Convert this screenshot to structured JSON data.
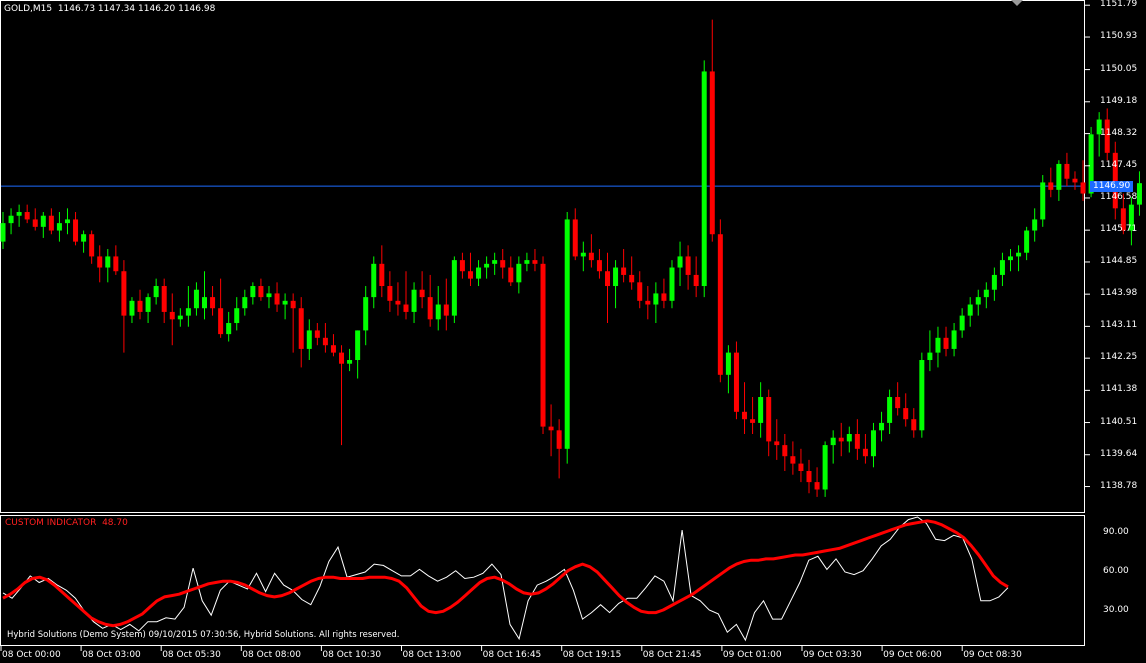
{
  "chart_info": {
    "symbol": "GOLD,M15",
    "open": "1146.73",
    "high": "1147.34",
    "low": "1146.20",
    "close": "1146.98",
    "current_price_tag": "1146.90"
  },
  "indicator": {
    "title": "CUSTOM INDICATOR",
    "value": "48.70",
    "copyright": "Hybrid Solutions (Demo System) 09/10/2015 07:30:56, Hybrid Solutions. All rights reserved."
  },
  "price_axis": [
    "1151.79",
    "1150.93",
    "1150.05",
    "1149.18",
    "1148.32",
    "1147.45",
    "1146.58",
    "1145.71",
    "1144.85",
    "1143.98",
    "1143.11",
    "1142.25",
    "1141.38",
    "1140.51",
    "1139.64",
    "1138.78"
  ],
  "indicator_axis": [
    "90.00",
    "60.00",
    "30.00"
  ],
  "time_axis": [
    "08 Oct 00:00",
    "08 Oct 03:00",
    "08 Oct 05:30",
    "08 Oct 08:00",
    "08 Oct 10:30",
    "08 Oct 13:00",
    "08 Oct 16:45",
    "08 Oct 19:15",
    "08 Oct 21:45",
    "09 Oct 01:00",
    "09 Oct 03:30",
    "09 Oct 06:00",
    "09 Oct 08:30"
  ],
  "colors": {
    "bull": "#00ff00",
    "bear": "#ff0000",
    "price_line": "#1c6bff",
    "signal": "#ff0000",
    "raw": "#ffffff"
  },
  "chart_data": {
    "type": "candlestick",
    "ylim": [
      1138.2,
      1151.85
    ],
    "candles": [
      [
        1145.4,
        1146.2,
        1145.2,
        1145.9
      ],
      [
        1145.9,
        1146.3,
        1145.6,
        1146.1
      ],
      [
        1146.1,
        1146.4,
        1145.8,
        1146.2
      ],
      [
        1146.2,
        1146.4,
        1145.9,
        1146.0
      ],
      [
        1146.0,
        1146.3,
        1145.7,
        1145.8
      ],
      [
        1145.8,
        1146.2,
        1145.5,
        1146.1
      ],
      [
        1146.1,
        1146.3,
        1145.6,
        1145.7
      ],
      [
        1145.7,
        1146.2,
        1145.4,
        1145.9
      ],
      [
        1145.9,
        1146.3,
        1145.6,
        1146.0
      ],
      [
        1146.0,
        1146.2,
        1145.3,
        1145.4
      ],
      [
        1145.4,
        1145.7,
        1145.1,
        1145.6
      ],
      [
        1145.6,
        1145.7,
        1144.8,
        1145.0
      ],
      [
        1145.0,
        1145.3,
        1144.3,
        1144.7
      ],
      [
        1144.7,
        1145.2,
        1144.3,
        1145.0
      ],
      [
        1145.0,
        1145.3,
        1144.5,
        1144.6
      ],
      [
        1144.6,
        1144.9,
        1142.4,
        1143.4
      ],
      [
        1143.4,
        1143.9,
        1143.2,
        1143.8
      ],
      [
        1143.8,
        1144.1,
        1143.3,
        1143.5
      ],
      [
        1143.5,
        1144.0,
        1143.2,
        1143.9
      ],
      [
        1143.9,
        1144.4,
        1143.7,
        1144.2
      ],
      [
        1144.2,
        1144.4,
        1143.2,
        1143.5
      ],
      [
        1143.5,
        1144.0,
        1142.6,
        1143.3
      ],
      [
        1143.3,
        1143.6,
        1143.1,
        1143.4
      ],
      [
        1143.4,
        1144.2,
        1143.1,
        1143.6
      ],
      [
        1143.6,
        1144.3,
        1143.4,
        1144.1
      ],
      [
        1143.6,
        1144.6,
        1143.3,
        1143.9
      ],
      [
        1143.9,
        1144.2,
        1143.4,
        1143.6
      ],
      [
        1143.6,
        1144.4,
        1142.8,
        1142.9
      ],
      [
        1142.9,
        1143.5,
        1142.7,
        1143.2
      ],
      [
        1143.2,
        1143.9,
        1143.0,
        1143.6
      ],
      [
        1143.6,
        1144.1,
        1143.4,
        1143.9
      ],
      [
        1143.9,
        1144.3,
        1143.7,
        1144.2
      ],
      [
        1144.2,
        1144.4,
        1143.8,
        1143.9
      ],
      [
        1143.9,
        1144.2,
        1143.6,
        1144.0
      ],
      [
        1144.0,
        1144.3,
        1143.5,
        1143.7
      ],
      [
        1143.7,
        1144.0,
        1143.3,
        1143.8
      ],
      [
        1143.8,
        1144.0,
        1142.4,
        1143.6
      ],
      [
        1143.6,
        1143.9,
        1142.0,
        1142.5
      ],
      [
        1142.5,
        1143.3,
        1142.2,
        1143.0
      ],
      [
        1143.0,
        1143.2,
        1142.6,
        1142.8
      ],
      [
        1142.8,
        1143.2,
        1142.4,
        1142.6
      ],
      [
        1142.6,
        1142.9,
        1142.3,
        1142.4
      ],
      [
        1142.4,
        1142.6,
        1139.9,
        1142.1
      ],
      [
        1142.1,
        1142.5,
        1141.9,
        1142.2
      ],
      [
        1142.2,
        1143.0,
        1141.7,
        1143.0
      ],
      [
        1143.0,
        1144.2,
        1142.6,
        1143.9
      ],
      [
        1143.9,
        1145.0,
        1143.6,
        1144.8
      ],
      [
        1144.8,
        1145.3,
        1143.9,
        1144.2
      ],
      [
        1144.2,
        1144.6,
        1143.5,
        1143.8
      ],
      [
        1143.8,
        1144.3,
        1143.4,
        1143.7
      ],
      [
        1143.7,
        1144.6,
        1143.3,
        1143.5
      ],
      [
        1143.5,
        1144.3,
        1143.2,
        1144.1
      ],
      [
        1144.1,
        1144.6,
        1143.6,
        1143.9
      ],
      [
        1143.9,
        1144.5,
        1143.1,
        1143.3
      ],
      [
        1143.3,
        1144.2,
        1143.0,
        1143.7
      ],
      [
        1143.7,
        1144.4,
        1143.0,
        1143.4
      ],
      [
        1143.4,
        1145.0,
        1143.2,
        1144.9
      ],
      [
        1144.9,
        1145.1,
        1144.4,
        1144.6
      ],
      [
        1144.6,
        1145.1,
        1144.2,
        1144.4
      ],
      [
        1144.4,
        1144.9,
        1144.2,
        1144.7
      ],
      [
        1144.7,
        1145.0,
        1144.4,
        1144.8
      ],
      [
        1144.8,
        1145.1,
        1144.5,
        1144.9
      ],
      [
        1144.9,
        1145.2,
        1144.4,
        1144.7
      ],
      [
        1144.7,
        1145.0,
        1144.2,
        1144.3
      ],
      [
        1144.3,
        1145.0,
        1144.0,
        1144.8
      ],
      [
        1144.8,
        1145.1,
        1144.6,
        1144.9
      ],
      [
        1144.9,
        1145.2,
        1144.6,
        1144.8
      ],
      [
        1144.8,
        1145.0,
        1140.2,
        1140.4
      ],
      [
        1140.4,
        1141.0,
        1139.6,
        1140.3
      ],
      [
        1140.3,
        1140.6,
        1139.0,
        1139.8
      ],
      [
        1139.8,
        1146.2,
        1139.4,
        1146.0
      ],
      [
        1146.0,
        1146.3,
        1144.9,
        1145.0
      ],
      [
        1145.0,
        1145.4,
        1144.6,
        1145.1
      ],
      [
        1145.1,
        1145.6,
        1144.7,
        1144.9
      ],
      [
        1144.9,
        1145.2,
        1144.4,
        1144.6
      ],
      [
        1144.6,
        1145.1,
        1143.2,
        1144.2
      ],
      [
        1144.2,
        1144.9,
        1143.6,
        1144.7
      ],
      [
        1144.7,
        1145.2,
        1144.3,
        1144.5
      ],
      [
        1144.5,
        1145.0,
        1144.1,
        1144.3
      ],
      [
        1144.3,
        1144.6,
        1143.6,
        1143.8
      ],
      [
        1143.8,
        1144.2,
        1143.3,
        1143.7
      ],
      [
        1143.7,
        1144.3,
        1143.2,
        1144.0
      ],
      [
        1144.0,
        1144.4,
        1143.6,
        1143.8
      ],
      [
        1143.8,
        1144.9,
        1143.6,
        1144.7
      ],
      [
        1144.7,
        1145.4,
        1144.2,
        1145.0
      ],
      [
        1145.0,
        1145.3,
        1144.1,
        1144.5
      ],
      [
        1144.5,
        1145.0,
        1143.9,
        1144.2
      ],
      [
        1144.2,
        1150.3,
        1143.9,
        1150.0
      ],
      [
        1150.0,
        1151.4,
        1145.4,
        1145.6
      ],
      [
        1145.6,
        1146.0,
        1141.6,
        1141.8
      ],
      [
        1141.8,
        1142.6,
        1141.3,
        1142.4
      ],
      [
        1142.4,
        1142.7,
        1140.6,
        1140.8
      ],
      [
        1140.8,
        1141.6,
        1140.2,
        1140.6
      ],
      [
        1140.6,
        1141.2,
        1140.2,
        1140.5
      ],
      [
        1140.5,
        1141.6,
        1140.1,
        1141.2
      ],
      [
        1141.2,
        1141.4,
        1139.6,
        1140.0
      ],
      [
        1140.0,
        1140.6,
        1139.5,
        1139.9
      ],
      [
        1139.9,
        1140.2,
        1139.2,
        1139.6
      ],
      [
        1139.6,
        1140.0,
        1139.1,
        1139.4
      ],
      [
        1139.4,
        1139.8,
        1138.9,
        1139.2
      ],
      [
        1139.2,
        1139.5,
        1138.6,
        1138.9
      ],
      [
        1138.9,
        1139.3,
        1138.5,
        1138.7
      ],
      [
        1138.7,
        1140.0,
        1138.5,
        1139.9
      ],
      [
        1139.9,
        1140.3,
        1139.4,
        1140.1
      ],
      [
        1140.1,
        1140.5,
        1139.6,
        1140.0
      ],
      [
        1140.0,
        1140.4,
        1139.7,
        1140.2
      ],
      [
        1140.2,
        1140.6,
        1139.5,
        1139.8
      ],
      [
        1139.8,
        1140.2,
        1139.4,
        1139.6
      ],
      [
        1139.6,
        1140.5,
        1139.3,
        1140.3
      ],
      [
        1140.3,
        1140.8,
        1140.0,
        1140.5
      ],
      [
        1140.5,
        1141.4,
        1140.2,
        1141.2
      ],
      [
        1141.2,
        1141.6,
        1140.7,
        1140.9
      ],
      [
        1140.9,
        1141.3,
        1140.4,
        1140.6
      ],
      [
        1140.6,
        1140.9,
        1140.1,
        1140.3
      ],
      [
        1140.3,
        1142.4,
        1140.1,
        1142.2
      ],
      [
        1142.2,
        1143.0,
        1141.9,
        1142.4
      ],
      [
        1142.4,
        1143.1,
        1142.0,
        1142.8
      ],
      [
        1142.8,
        1143.1,
        1142.3,
        1142.5
      ],
      [
        1142.5,
        1143.2,
        1142.3,
        1143.0
      ],
      [
        1143.0,
        1143.6,
        1142.8,
        1143.4
      ],
      [
        1143.4,
        1143.9,
        1143.1,
        1143.7
      ],
      [
        1143.7,
        1144.1,
        1143.4,
        1143.9
      ],
      [
        1143.9,
        1144.3,
        1143.6,
        1144.1
      ],
      [
        1144.1,
        1144.7,
        1143.8,
        1144.5
      ],
      [
        1144.5,
        1145.1,
        1144.2,
        1144.9
      ],
      [
        1144.9,
        1145.2,
        1144.6,
        1145.0
      ],
      [
        1145.0,
        1145.3,
        1144.6,
        1145.1
      ],
      [
        1145.1,
        1145.8,
        1144.9,
        1145.7
      ],
      [
        1145.7,
        1146.3,
        1145.4,
        1146.0
      ],
      [
        1146.0,
        1147.2,
        1145.8,
        1147.0
      ],
      [
        1147.0,
        1147.4,
        1146.6,
        1146.8
      ],
      [
        1146.8,
        1147.6,
        1146.5,
        1147.5
      ],
      [
        1147.5,
        1147.8,
        1146.9,
        1147.1
      ],
      [
        1147.1,
        1147.3,
        1146.8,
        1147.0
      ],
      [
        1147.0,
        1147.6,
        1146.5,
        1146.7
      ],
      [
        1146.7,
        1148.5,
        1146.6,
        1148.3
      ],
      [
        1148.3,
        1148.9,
        1147.7,
        1148.7
      ],
      [
        1148.7,
        1149.0,
        1147.6,
        1147.8
      ],
      [
        1147.8,
        1148.1,
        1146.0,
        1146.3
      ],
      [
        1146.3,
        1146.7,
        1145.6,
        1145.7
      ],
      [
        1145.7,
        1146.6,
        1145.3,
        1146.4
      ],
      [
        1146.4,
        1147.3,
        1146.1,
        1146.98
      ]
    ],
    "indicator_ylim": [
      5,
      102
    ],
    "indicator_raw": [
      44,
      40,
      48,
      57,
      52,
      55,
      50,
      46,
      40,
      30,
      22,
      17,
      20,
      16,
      20,
      15,
      22,
      22,
      25,
      24,
      33,
      63,
      38,
      27,
      46,
      53,
      50,
      47,
      59,
      45,
      59,
      50,
      46,
      39,
      35,
      49,
      68,
      79,
      56,
      58,
      60,
      66,
      65,
      61,
      57,
      57,
      62,
      57,
      53,
      56,
      61,
      55,
      56,
      59,
      66,
      58,
      20,
      9,
      38,
      50,
      53,
      57,
      62,
      46,
      24,
      29,
      35,
      29,
      36,
      40,
      40,
      48,
      57,
      53,
      38,
      92,
      42,
      38,
      31,
      28,
      14,
      20,
      8,
      29,
      38,
      24,
      24,
      38,
      52,
      69,
      72,
      62,
      70,
      60,
      58,
      61,
      70,
      80,
      85,
      94,
      100,
      102,
      97,
      85,
      84,
      88,
      86,
      70,
      38,
      38,
      41,
      48
    ],
    "indicator_signal": [
      40,
      43,
      47,
      52,
      55,
      56,
      54,
      50,
      45,
      40,
      35,
      30,
      25,
      22,
      20,
      19,
      20,
      22,
      25,
      28,
      33,
      38,
      41,
      42,
      43,
      45,
      47,
      49,
      51,
      52,
      53,
      53,
      52,
      50,
      47,
      44,
      42,
      41,
      42,
      44,
      47,
      50,
      53,
      55,
      56,
      56,
      55,
      55,
      55,
      55,
      56,
      56,
      56,
      55,
      53,
      48,
      41,
      34,
      30,
      29,
      30,
      33,
      37,
      42,
      47,
      52,
      55,
      56,
      54,
      51,
      47,
      44,
      43,
      44,
      47,
      51,
      56,
      61,
      64,
      66,
      64,
      60,
      54,
      48,
      42,
      37,
      33,
      30,
      29,
      29,
      31,
      34,
      37,
      40,
      43,
      47,
      51,
      55,
      59,
      63,
      66,
      68,
      69,
      69,
      70,
      70,
      71,
      72,
      73,
      73,
      74,
      75,
      76,
      77,
      78,
      80,
      82,
      84,
      86,
      88,
      90,
      92,
      94,
      96,
      97,
      98,
      99,
      98,
      96,
      93,
      90,
      86,
      80,
      73,
      65,
      57,
      52,
      48.7
    ]
  }
}
